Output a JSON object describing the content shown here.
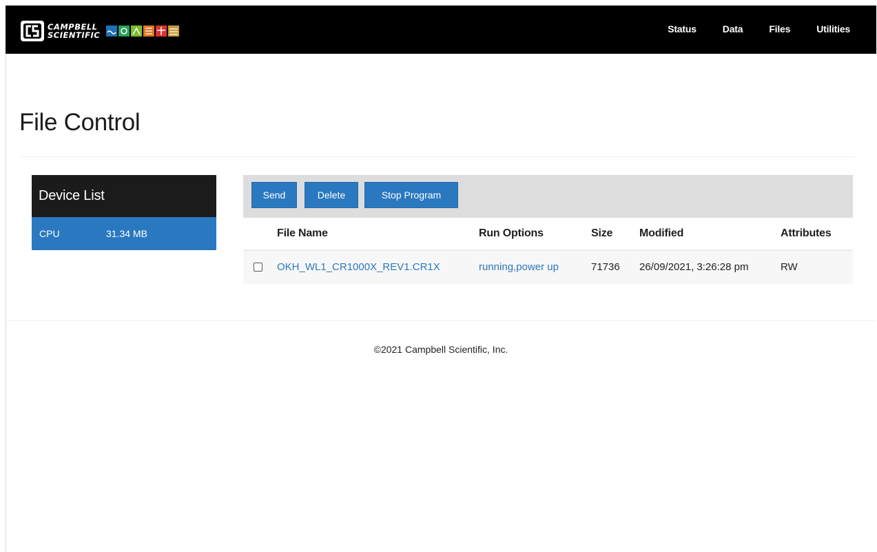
{
  "header": {
    "logo": {
      "text_line1": "CAMPBELL",
      "text_line2": "SCIENTIFIC",
      "tiles": [
        {
          "color": "#1f6fb5",
          "icon": "water-tile-icon"
        },
        {
          "color": "#2aa05a",
          "icon": "weather-tile-icon"
        },
        {
          "color": "#7dbb2f",
          "icon": "soil-tile-icon"
        },
        {
          "color": "#e07822",
          "icon": "energy-tile-icon"
        },
        {
          "color": "#d9332f",
          "icon": "structure-tile-icon"
        },
        {
          "color": "#c79a3b",
          "icon": "infrastructure-tile-icon"
        }
      ]
    },
    "nav": [
      "Status",
      "Data",
      "Files",
      "Utilities"
    ]
  },
  "page": {
    "title": "File Control"
  },
  "device_list": {
    "title": "Device List",
    "devices": [
      {
        "name": "CPU",
        "size": "31.34 MB"
      }
    ]
  },
  "toolbar": {
    "send_label": "Send",
    "delete_label": "Delete",
    "stop_label": "Stop Program"
  },
  "files": {
    "columns": [
      "File Name",
      "Run Options",
      "Size",
      "Modified",
      "Attributes"
    ],
    "rows": [
      {
        "name": "OKH_WL1_CR1000X_REV1.CR1X",
        "run_options": "running,power up",
        "size": "71736",
        "modified": "26/09/2021, 3:26:28 pm",
        "attributes": "RW",
        "selected": false
      }
    ]
  },
  "footer": {
    "copyright": "©2021 Campbell Scientific, Inc."
  },
  "colors": {
    "navbar_bg": "#000000",
    "accent_blue": "#2a78c0",
    "device_header_bg": "#1b1b1b",
    "toolbar_bg": "#dddddd"
  }
}
